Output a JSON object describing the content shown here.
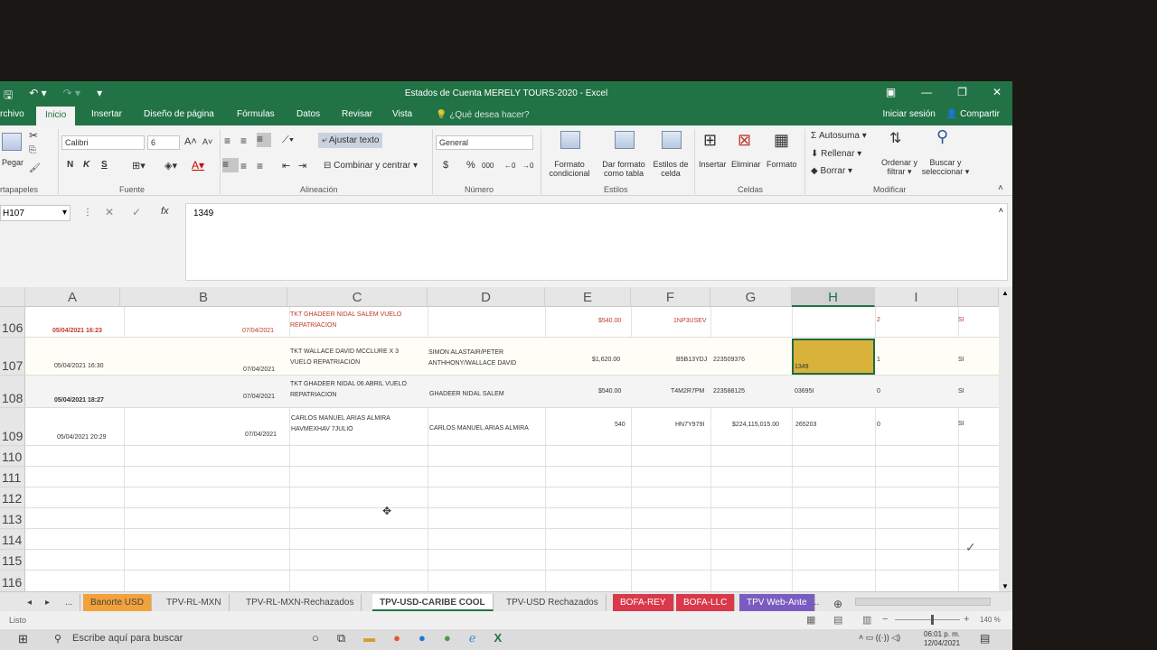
{
  "title_bar": {
    "title": "Estados de Cuenta MERELY TOURS-2020 - Excel",
    "save_icon": "save-icon",
    "undo_icon": "undo-icon"
  },
  "ribbon_tabs": [
    "rchivo",
    "Inicio",
    "Insertar",
    "Diseño de página",
    "Fórmulas",
    "Datos",
    "Revisar",
    "Vista"
  ],
  "tell_me": "¿Qué desea hacer?",
  "account": {
    "signin": "Iniciar sesión",
    "share": "Compartir"
  },
  "ribbon": {
    "paste": "Pegar",
    "clipboard_label": "rtapapeles",
    "font_name": "Calibri",
    "font_size": "6",
    "bold": "N",
    "italic": "K",
    "underline": "S",
    "font_label": "Fuente",
    "wrap_text": "Ajustar texto",
    "merge_center": "Combinar y centrar",
    "alignment_label": "Alineación",
    "number_format": "General",
    "currency": "$",
    "percent": "%",
    "thousands": "000",
    "number_label": "Número",
    "cond_format": [
      "Formato",
      "condicional"
    ],
    "format_table": [
      "Dar formato",
      "como tabla"
    ],
    "cell_styles": [
      "Estilos de",
      "celda"
    ],
    "styles_label": "Estilos",
    "insert": "Insertar",
    "delete": "Eliminar",
    "format": "Formato",
    "cells_label": "Celdas",
    "autosum": "Autosuma",
    "fill": "Rellenar",
    "clear": "Borrar",
    "sort_filter": [
      "Ordenar y",
      "filtrar"
    ],
    "find_select": [
      "Buscar y",
      "seleccionar"
    ],
    "modify_label": "Modificar"
  },
  "formula_bar": {
    "name_box": "H107",
    "value": "1349"
  },
  "columns": [
    "A",
    "B",
    "C",
    "D",
    "E",
    "F",
    "G",
    "H",
    "I"
  ],
  "rows": [
    {
      "num": "106",
      "a": "05/04/2021 16:23",
      "b": "07/04/2021",
      "c": "TKT GHADEER NIDAL SALEM VUELO\nREPATRIACION",
      "d": "",
      "e": "$540.00",
      "f": "1NP3USEV",
      "g": "",
      "h": "",
      "i": "2",
      "j": "SI",
      "style": "red"
    },
    {
      "num": "107",
      "a": "05/04/2021 16:30",
      "b": "07/04/2021",
      "c": "TKT WALLACE DAVID MCCLURE X 3\nVUELO REPATRIACION",
      "d": "SIMON ALASTAIR/PETER\nANTHHONY/WALLACE DAVID",
      "e": "$1,620.00",
      "f": "B5B13YDJ",
      "g": "223509376",
      "h": "1349",
      "i": "1",
      "j": "SI",
      "style": ""
    },
    {
      "num": "108",
      "a": "05/04/2021 18:27",
      "b": "07/04/2021",
      "c": "TKT GHADEER NIDAL 06 ABRIL VUELO\nREPATRIACION",
      "d": "GHADEER NIDAL SALEM",
      "e": "$540.00",
      "f": "T4M2R7PM",
      "g": "223588125",
      "h": "03695I",
      "i": "0",
      "j": "SI",
      "style": "bold"
    },
    {
      "num": "109",
      "a": "05/04/2021 20:29",
      "b": "07/04/2021",
      "c": "CARLOS MANUEL ARIAS ALMIRA\nHAVMEXHAV 7JULIO",
      "d": "CARLOS MANUEL ARIAS ALMIRA",
      "e": "540",
      "f": "HN7Y979I",
      "g": "$224,115,015.00",
      "h": "265203",
      "i": "0",
      "j": "SI",
      "style": ""
    }
  ],
  "empty_rows": [
    "110",
    "111",
    "112",
    "113",
    "114",
    "115",
    "116"
  ],
  "sheet_tabs": [
    {
      "label": "...",
      "color": ""
    },
    {
      "label": "Banorte USD",
      "color": "#f2a23a"
    },
    {
      "label": "TPV-RL-MXN",
      "color": ""
    },
    {
      "label": "TPV-RL-MXN-Rechazados",
      "color": ""
    },
    {
      "label": "TPV-USD-CARIBE COOL",
      "color": "#ffffff"
    },
    {
      "label": "TPV-USD Rechazados",
      "color": ""
    },
    {
      "label": "BOFA-REY",
      "color": "#d9394a"
    },
    {
      "label": "BOFA-LLC",
      "color": "#d9394a"
    },
    {
      "label": "TPV Web-Ante",
      "color": "#7a5cc0"
    },
    {
      "label": "...",
      "color": ""
    }
  ],
  "status": {
    "ready": "Listo",
    "zoom": "140 %"
  },
  "taskbar": {
    "search": "Escribe aquí para buscar",
    "time": "06:01 p. m.",
    "date": "12/04/2021"
  }
}
